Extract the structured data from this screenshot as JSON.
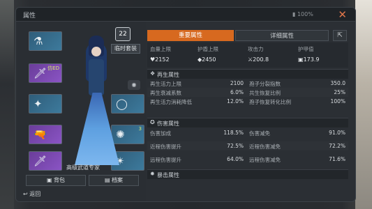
{
  "window": {
    "title": "属性",
    "battery": "100%"
  },
  "left": {
    "badge": "22",
    "temp_outfit": "临时套装",
    "expert_title": "高级武道专家",
    "bag": "背包",
    "archive": "档案",
    "back": "返回",
    "slots": [
      {
        "tag": "",
        "glyph": "⚗"
      },
      {
        "tag": "仿ED",
        "glyph": "🗡"
      },
      {
        "tag": "",
        "glyph": "✦"
      },
      {
        "tag": "",
        "glyph": "🔫"
      },
      {
        "tag": "",
        "glyph": "🗡"
      }
    ],
    "right_slots": [
      {
        "tag": "",
        "glyph": "◯"
      },
      {
        "tag": "3",
        "glyph": "✺"
      },
      {
        "tag": "",
        "glyph": "✴"
      }
    ]
  },
  "tabs": {
    "main": "重要属性",
    "detail": "详细属性"
  },
  "stats": [
    {
      "label": "血量上限",
      "value": "2152",
      "icon": "♥"
    },
    {
      "label": "护盾上限",
      "value": "2450",
      "icon": "◆"
    },
    {
      "label": "攻击力",
      "value": "200.8",
      "icon": "⚔"
    },
    {
      "label": "护甲值",
      "value": "173.9",
      "icon": "▣"
    }
  ],
  "sections": [
    {
      "title": "再生属性",
      "rows": [
        [
          {
            "l": "再生活力上限",
            "v": "2100"
          },
          {
            "l": "孢子分裂指数",
            "v": "350.0"
          }
        ],
        [
          {
            "l": "再生衰减系数",
            "v": "6.0%"
          },
          {
            "l": "共生恢复比例",
            "v": "25%"
          }
        ],
        [
          {
            "l": "再生活力消耗降低",
            "v": "12.0%"
          },
          {
            "l": "孢子恢复转化比例",
            "v": "100%"
          }
        ]
      ]
    },
    {
      "title": "伤害属性",
      "rows": [
        [
          {
            "l": "伤害加成",
            "v": "118.5%"
          },
          {
            "l": "伤害减免",
            "v": "91.0%"
          }
        ],
        [
          {
            "l": "近程伤害提升",
            "v": "72.5%"
          },
          {
            "l": "近程伤害减免",
            "v": "72.2%"
          }
        ],
        [
          {
            "l": "远程伤害提升",
            "v": "64.0%"
          },
          {
            "l": "远程伤害减免",
            "v": "71.6%"
          }
        ]
      ]
    },
    {
      "title": "暴击属性",
      "rows": []
    }
  ],
  "colors": {
    "accent": "#d7691f",
    "bg": "#2b2f34"
  }
}
